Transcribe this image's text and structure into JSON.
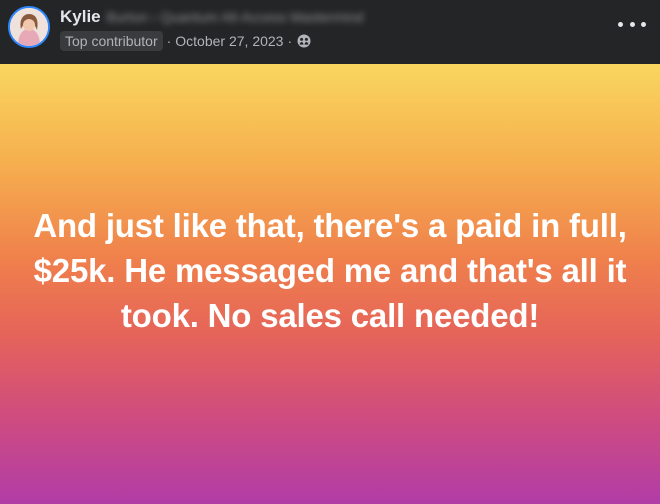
{
  "post": {
    "author": {
      "name": "Kylie",
      "blurred_text": "Burton › Quantum All-Access Mastermind",
      "avatar_icon": "profile-photo"
    },
    "badge": "Top contributor",
    "separator": "·",
    "date": "October 27, 2023",
    "audience_icon": "group-members-icon",
    "more_icon": "more-options-icon",
    "text": "And just like that, there's a paid in full, $25k. He messaged me and that's all it took. No sales call needed!",
    "background_gradient": [
      "#f9d65f",
      "#f6b04e",
      "#ef7f4c",
      "#e5635a",
      "#cf4c7f",
      "#b13ca7"
    ]
  },
  "colors": {
    "header_bg": "#242526",
    "primary_text": "#e4e6eb",
    "secondary_text": "#b0b3b8",
    "badge_bg": "#3a3b3c",
    "avatar_ring": "#2d88ff"
  }
}
